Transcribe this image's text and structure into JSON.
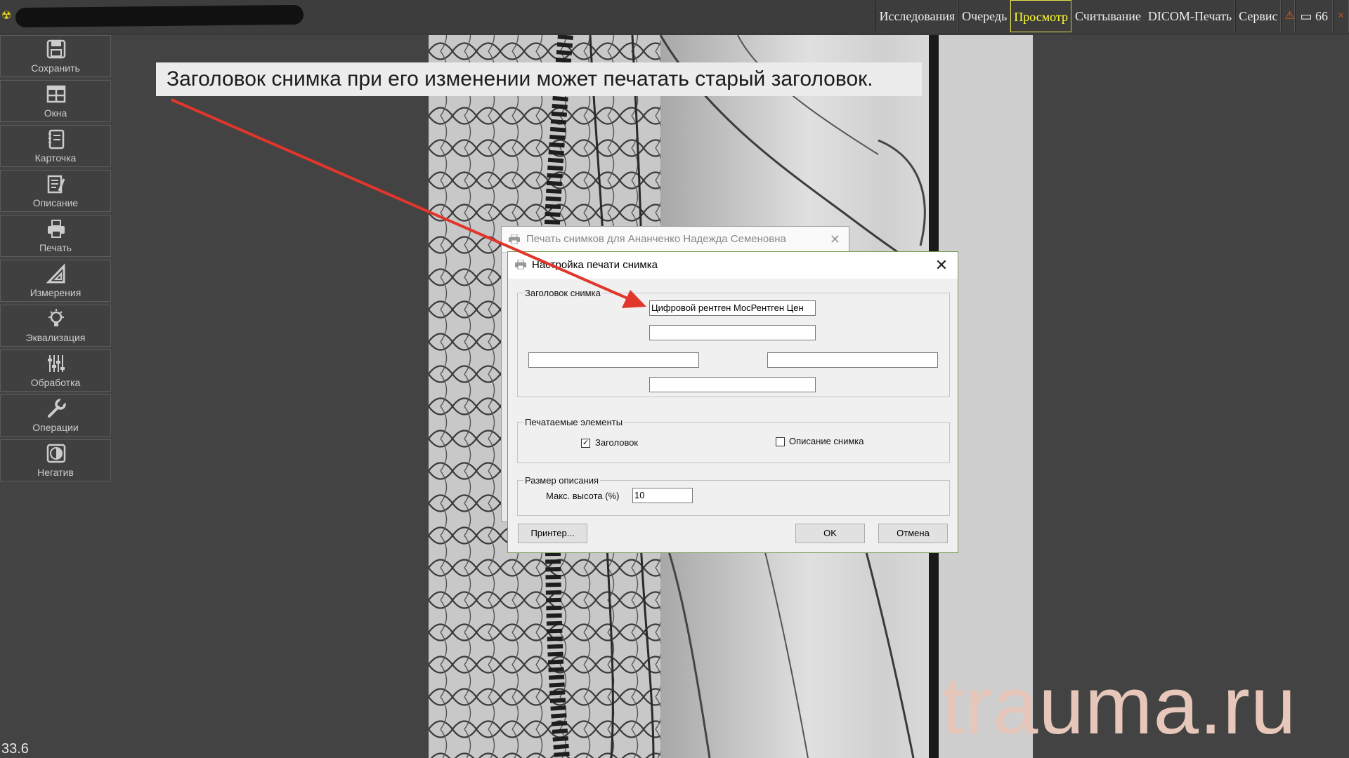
{
  "topbar": {
    "tabs": [
      {
        "label": "Исследования",
        "active": false
      },
      {
        "label": "Очередь",
        "active": false
      },
      {
        "label": "Просмотр",
        "active": true
      },
      {
        "label": "Считывание",
        "active": false
      },
      {
        "label": "DICOM-Печать",
        "active": false
      },
      {
        "label": "Сервис",
        "active": false
      }
    ],
    "counter": "66",
    "icons": [
      "radiation-icon",
      "warning-icon",
      "storage-icon",
      "close-icon"
    ],
    "active_color": "#ffff33"
  },
  "toolbar": {
    "items": [
      {
        "label": "Сохранить",
        "icon": "save-icon"
      },
      {
        "label": "Окна",
        "icon": "windows-grid-icon"
      },
      {
        "label": "Карточка",
        "icon": "notebook-icon"
      },
      {
        "label": "Описание",
        "icon": "document-edit-icon"
      },
      {
        "label": "Печать",
        "icon": "printer-icon"
      },
      {
        "label": "Измерения",
        "icon": "ruler-triangle-icon"
      },
      {
        "label": "Эквализация",
        "icon": "bulb-icon"
      },
      {
        "label": "Обработка",
        "icon": "sliders-icon"
      },
      {
        "label": "Операции",
        "icon": "wrench-icon"
      },
      {
        "label": "Негатив",
        "icon": "negative-icon"
      }
    ]
  },
  "annotation": {
    "text": "Заголовок снимка при его изменении может печатать старый заголовок.",
    "arrow_color": "#e0362b"
  },
  "background_dialog": {
    "title": "Печать снимков для Ананченко Надежда Семеновна"
  },
  "dialog": {
    "title": "Настройка печати снимка",
    "header_group": {
      "legend": "Заголовок снимка",
      "field_top": "Цифровой рентген МосРентген Цен",
      "field_2": "",
      "field_left": "",
      "field_right": "",
      "field_bottom": ""
    },
    "elements_group": {
      "legend": "Печатаемые элементы",
      "header_checkbox": {
        "label": "Заголовок",
        "checked": true
      },
      "description_checkbox": {
        "label": "Описание снимка",
        "checked": false
      }
    },
    "size_group": {
      "legend": "Размер описания",
      "max_height_label": "Макс. высота (%)",
      "max_height_value": "10"
    },
    "buttons": {
      "printer": "Принтер...",
      "ok": "OK",
      "cancel": "Отмена"
    }
  },
  "watermark": "trauma.ru",
  "zoom_readout": "33.6"
}
